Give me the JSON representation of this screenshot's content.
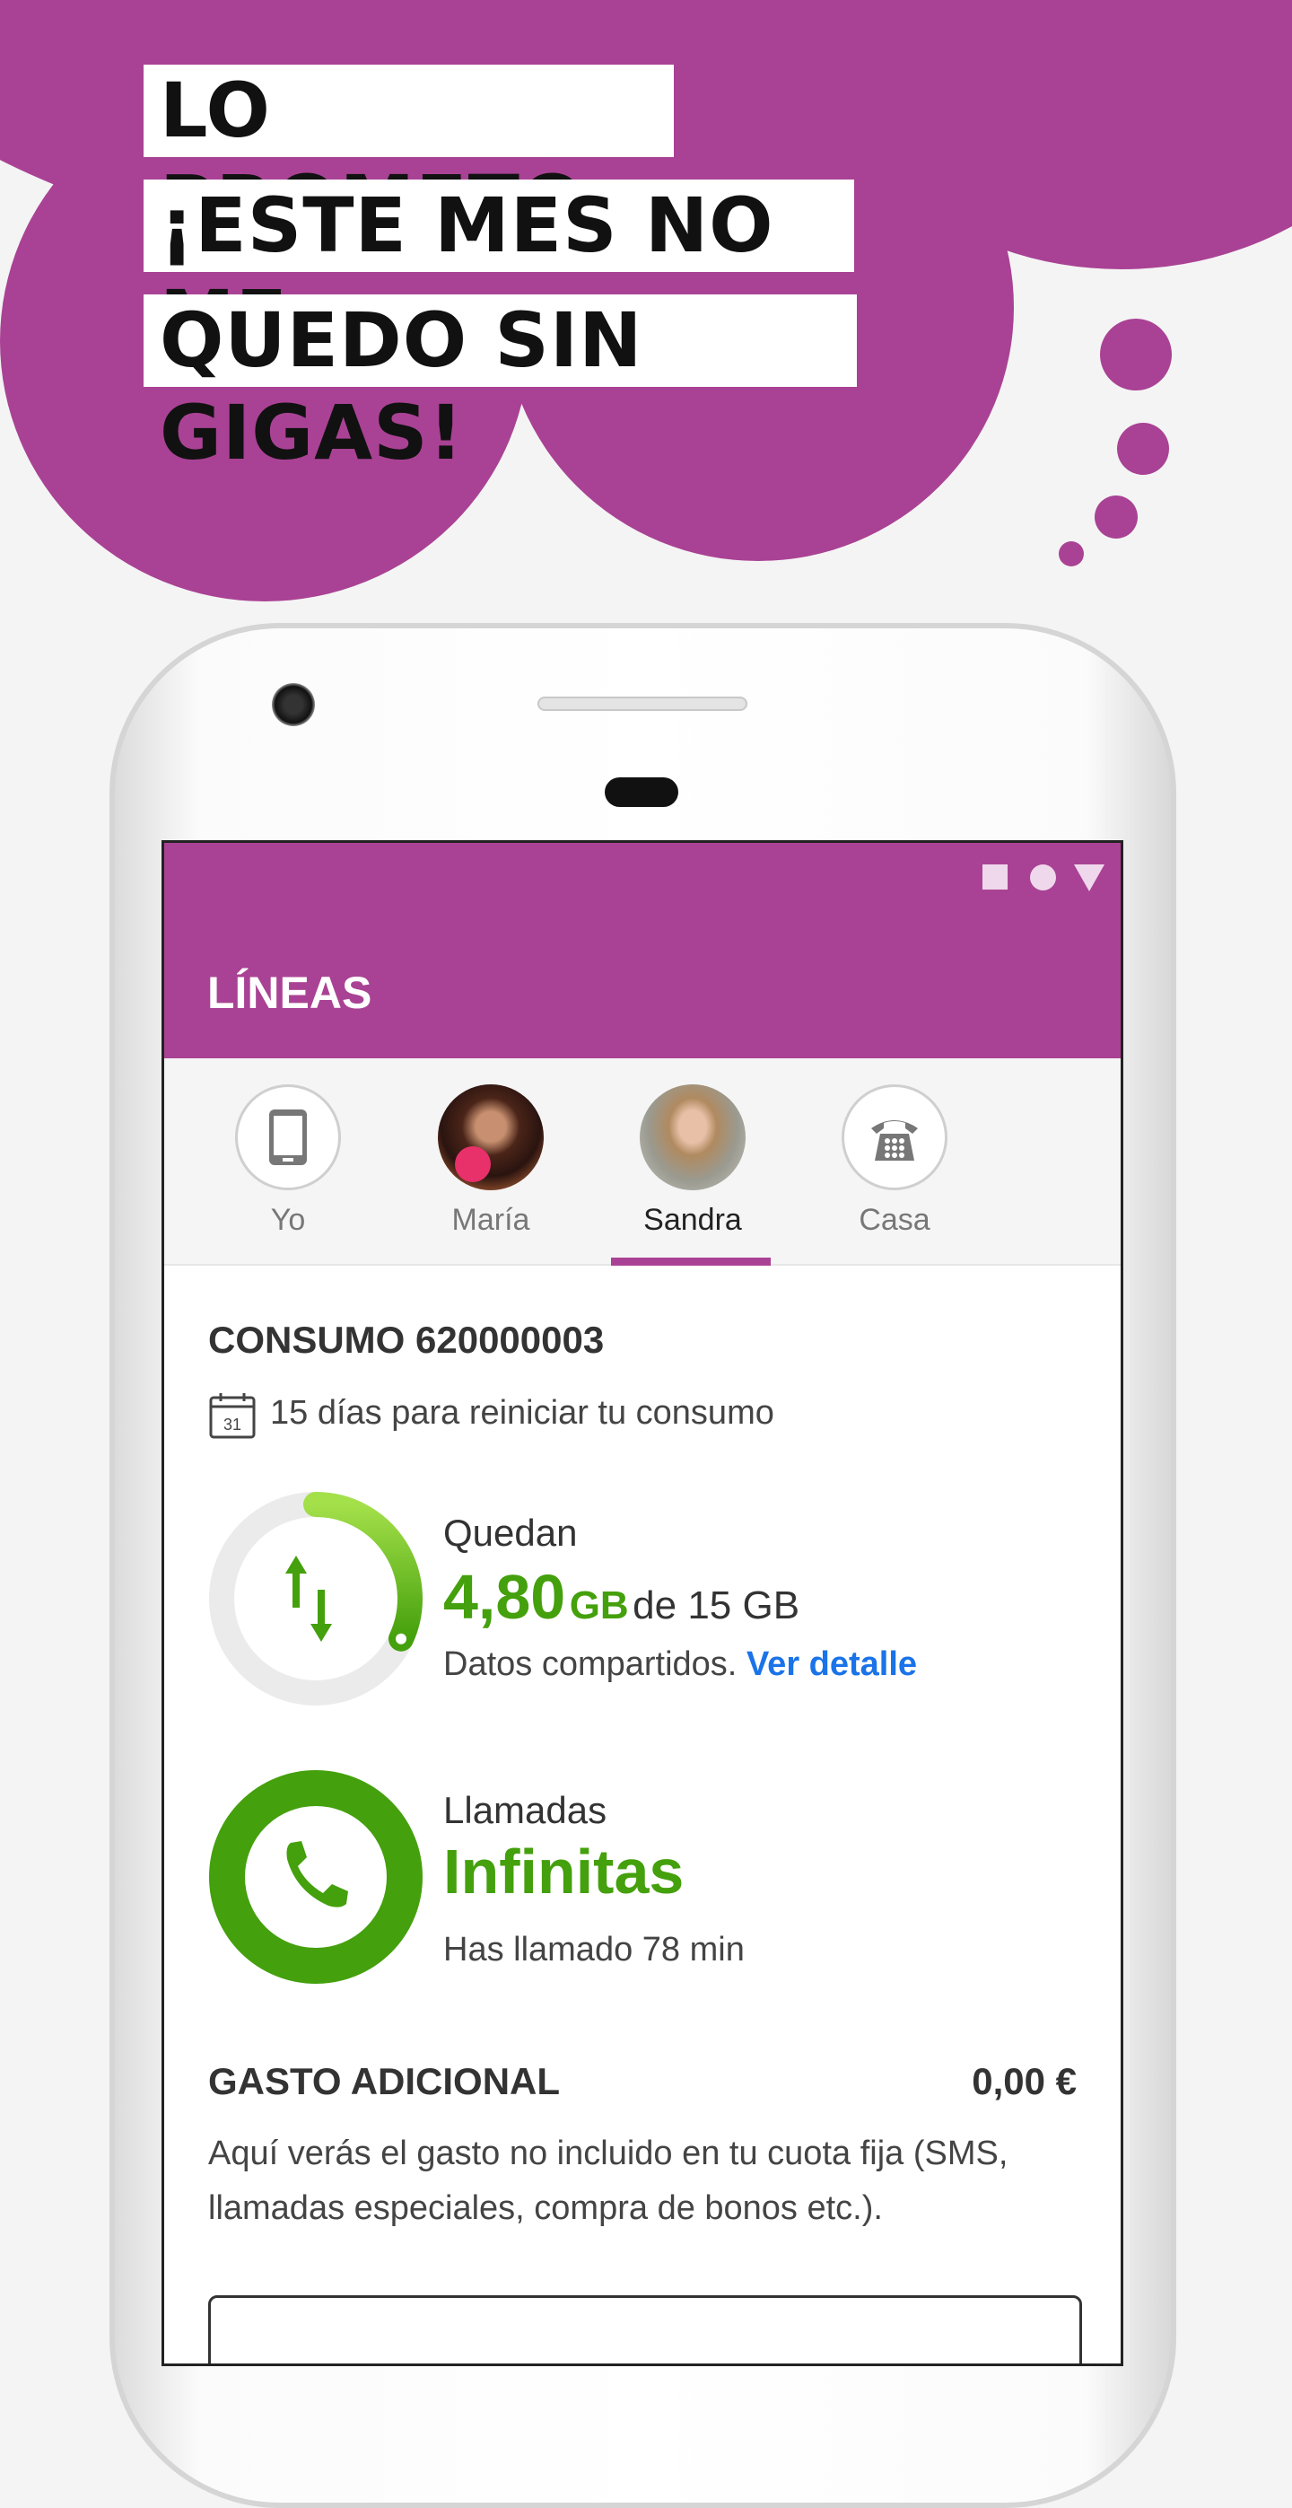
{
  "promo": {
    "lines": [
      "LO PROMETO,",
      "¡ESTE MES NO ME",
      "QUEDO SIN GIGAS!"
    ],
    "brand_color": "#a94294"
  },
  "status_bar": {
    "icons": [
      "square-icon",
      "circle-icon",
      "triangle-icon"
    ]
  },
  "app_bar": {
    "title": "LÍNEAS"
  },
  "tabs": [
    {
      "label": "Yo",
      "icon": "mobile-phone-icon",
      "active": false
    },
    {
      "label": "María",
      "icon": "avatar",
      "active": false
    },
    {
      "label": "Sandra",
      "icon": "avatar",
      "active": true
    },
    {
      "label": "Casa",
      "icon": "landline-phone-icon",
      "active": false
    }
  ],
  "consumo": {
    "title": "CONSUMO 620000003",
    "reset_text": "15 días para reiniciar tu consumo",
    "calendar_day": "31",
    "data": {
      "label": "Quedan",
      "amount": "4,80",
      "unit": "GB",
      "of_text": "de 15 GB",
      "remaining_fraction": 0.32,
      "note": "Datos compartidos.",
      "link": "Ver detalle"
    },
    "calls": {
      "label": "Llamadas",
      "value": "Infinitas",
      "used": "Has llamado 78 min"
    }
  },
  "gasto": {
    "title": "GASTO ADICIONAL",
    "amount": "0,00 €",
    "description": "Aquí verás el gasto no incluido en tu cuota fija (SMS, llamadas especiales, compra de bonos etc.)."
  },
  "colors": {
    "green": "#44a00c",
    "light_green": "#9fdd48",
    "link": "#1a73e8"
  }
}
